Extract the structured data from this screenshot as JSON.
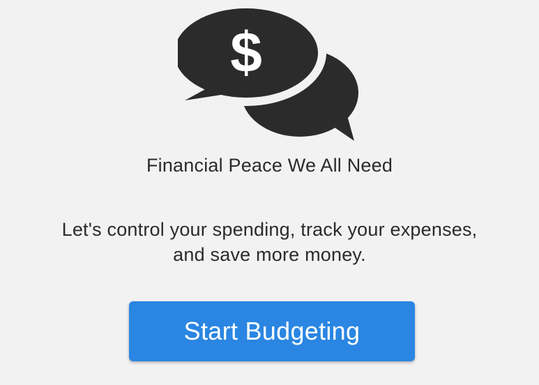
{
  "logo": {
    "icon": "speech-bubbles-dollar-icon",
    "symbol": "$",
    "color": "#2b2b2b"
  },
  "tagline": "Financial Peace We All Need",
  "description": {
    "line1": "Let's control your spending, track your expenses,",
    "line2": "and save more money."
  },
  "cta": {
    "label": "Start Budgeting",
    "color": "#2a86e2"
  },
  "background_color": "#f2f2f2"
}
